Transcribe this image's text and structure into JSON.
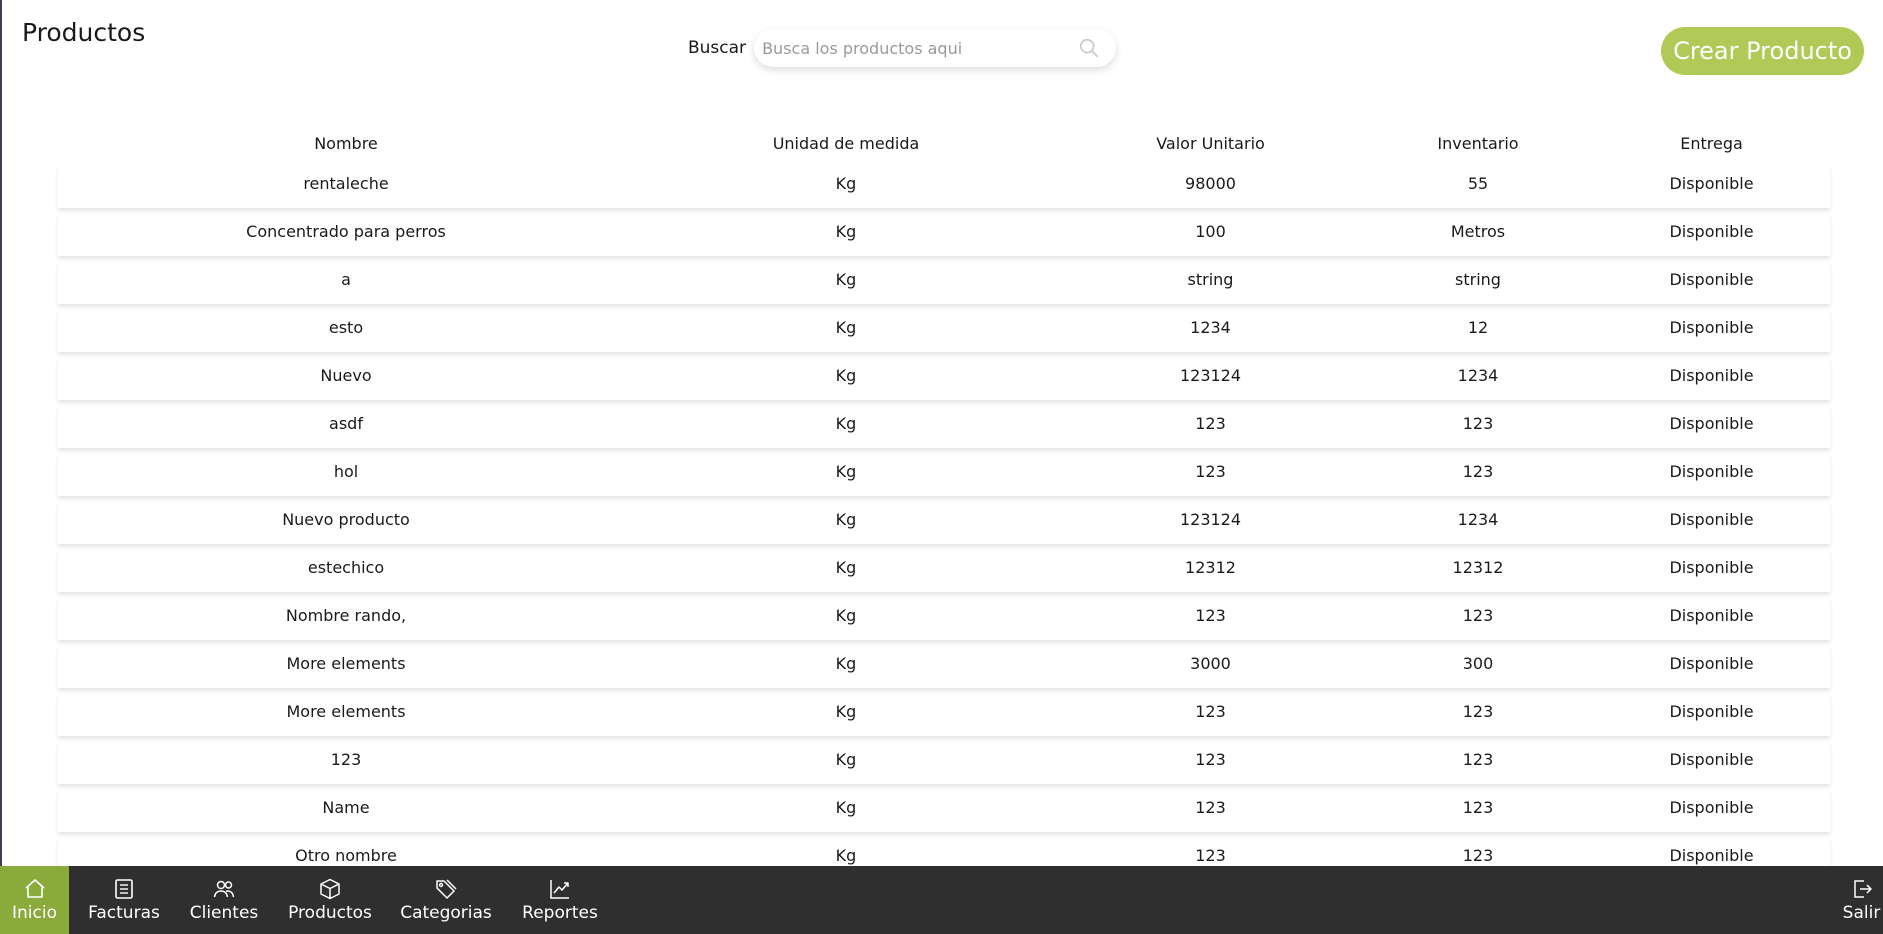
{
  "header": {
    "title": "Productos",
    "search_label": "Buscar",
    "search_placeholder": "Busca los productos aqui",
    "search_value": "",
    "create_button": "Crear Producto"
  },
  "colors": {
    "accent": "#b1c957",
    "nav_active": "#8aab3c",
    "nav_bg": "#2f2f2f"
  },
  "table": {
    "columns": [
      "Nombre",
      "Unidad de medida",
      "Valor Unitario",
      "Inventario",
      "Entrega"
    ],
    "rows": [
      [
        "rentaleche",
        "Kg",
        "98000",
        "55",
        "Disponible"
      ],
      [
        "Concentrado para perros",
        "Kg",
        "100",
        "Metros",
        "Disponible"
      ],
      [
        "a",
        "Kg",
        "string",
        "string",
        "Disponible"
      ],
      [
        "esto",
        "Kg",
        "1234",
        "12",
        "Disponible"
      ],
      [
        "Nuevo",
        "Kg",
        "123124",
        "1234",
        "Disponible"
      ],
      [
        "asdf",
        "Kg",
        "123",
        "123",
        "Disponible"
      ],
      [
        "hol",
        "Kg",
        "123",
        "123",
        "Disponible"
      ],
      [
        "Nuevo producto",
        "Kg",
        "123124",
        "1234",
        "Disponible"
      ],
      [
        "estechico",
        "Kg",
        "12312",
        "12312",
        "Disponible"
      ],
      [
        "Nombre rando,",
        "Kg",
        "123",
        "123",
        "Disponible"
      ],
      [
        "More elements",
        "Kg",
        "3000",
        "300",
        "Disponible"
      ],
      [
        "More elements",
        "Kg",
        "123",
        "123",
        "Disponible"
      ],
      [
        "123",
        "Kg",
        "123",
        "123",
        "Disponible"
      ],
      [
        "Name",
        "Kg",
        "123",
        "123",
        "Disponible"
      ],
      [
        "Otro nombre",
        "Kg",
        "123",
        "123",
        "Disponible"
      ]
    ]
  },
  "nav": {
    "items": [
      {
        "label": "Inicio",
        "icon": "home-icon",
        "active": true
      },
      {
        "label": "Facturas",
        "icon": "invoice-icon"
      },
      {
        "label": "Clientes",
        "icon": "users-icon"
      },
      {
        "label": "Productos",
        "icon": "box-icon"
      },
      {
        "label": "Categorias",
        "icon": "tag-icon"
      },
      {
        "label": "Reportes",
        "icon": "chart-icon"
      }
    ],
    "logout": {
      "label": "Salir",
      "icon": "logout-icon"
    }
  }
}
